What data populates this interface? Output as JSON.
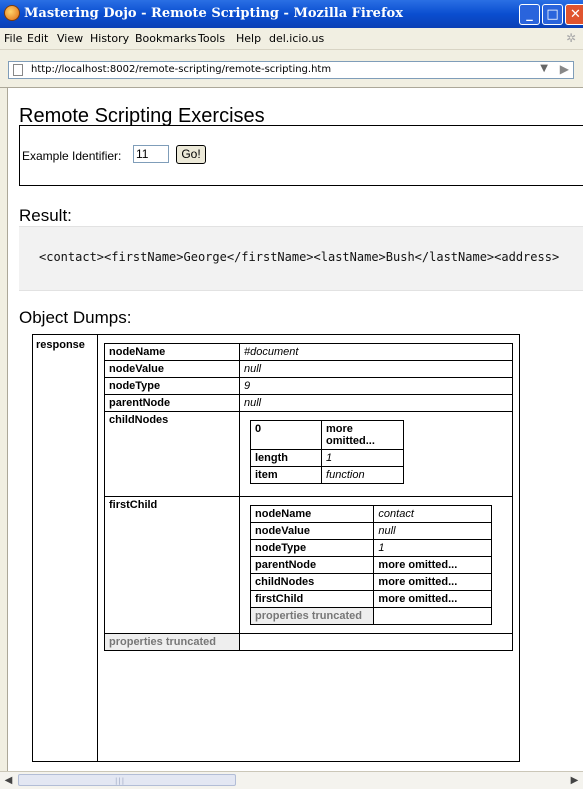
{
  "window": {
    "title": "Mastering Dojo - Remote Scripting - Mozilla Firefox"
  },
  "menu": [
    "File",
    "Edit",
    "View",
    "History",
    "Bookmarks",
    "Tools",
    "Help",
    "del.icio.us"
  ],
  "address": {
    "url": "http://localhost:8002/remote-scripting/remote-scripting.htm"
  },
  "page": {
    "title": "Remote Scripting Exercises",
    "form": {
      "label": "Example Identifier:",
      "value": "11",
      "button": "Go!"
    },
    "result_heading": "Result:",
    "result_code": "<contact><firstName>George</firstName><lastName>Bush</lastName><address>",
    "dumps_heading": "Object Dumps:"
  },
  "dump": {
    "root_key": "response",
    "rows": {
      "nodeName": {
        "key": "nodeName",
        "value": "#document"
      },
      "nodeValue": {
        "key": "nodeValue",
        "value": "null"
      },
      "nodeType": {
        "key": "nodeType",
        "value": "9"
      },
      "parentNode": {
        "key": "parentNode",
        "value": "null"
      },
      "childNodes": {
        "key": "childNodes",
        "children": [
          {
            "key": "0",
            "value": "more omitted..."
          },
          {
            "key": "length",
            "value": "1"
          },
          {
            "key": "item",
            "value": "function"
          }
        ]
      },
      "firstChild": {
        "key": "firstChild",
        "children": [
          {
            "key": "nodeName",
            "value": "contact"
          },
          {
            "key": "nodeValue",
            "value": "null"
          },
          {
            "key": "nodeType",
            "value": "1"
          },
          {
            "key": "parentNode",
            "value": "more omitted..."
          },
          {
            "key": "childNodes",
            "value": "more omitted..."
          },
          {
            "key": "firstChild",
            "value": "more omitted..."
          }
        ],
        "truncated": "properties truncated"
      }
    },
    "truncated": "properties truncated"
  }
}
